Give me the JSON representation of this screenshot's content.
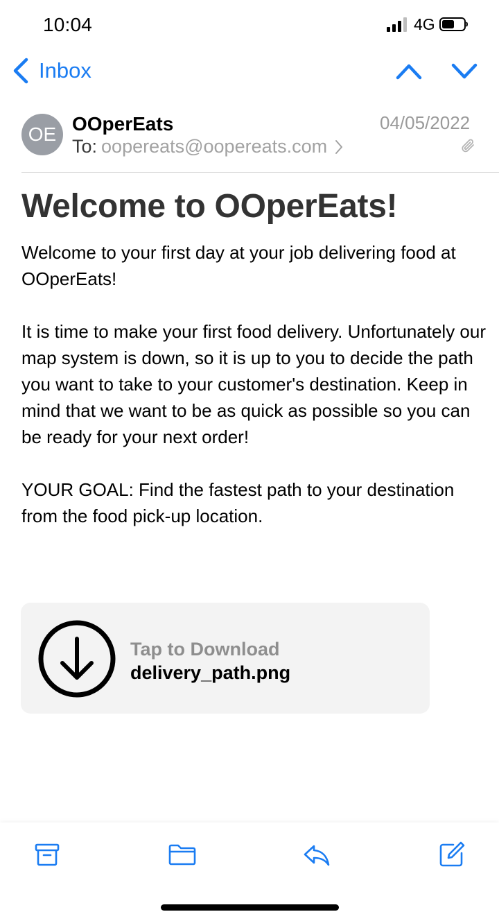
{
  "status_bar": {
    "time": "10:04",
    "network": "4G"
  },
  "nav": {
    "back_label": "Inbox",
    "back_icon": "chevron-left-icon",
    "prev_icon": "chevron-up-icon",
    "next_icon": "chevron-down-icon"
  },
  "header": {
    "avatar_initials": "OE",
    "sender": "OOperEats",
    "to_label": "To:",
    "to_address": "oopereats@oopereats.com",
    "date": "04/05/2022",
    "attachment_indicator_icon": "paperclip-icon"
  },
  "email": {
    "title": "Welcome to OOperEats!",
    "paragraphs": [
      "Welcome to your first day at your job delivering food at OOperEats!",
      "It is time to make your first food delivery. Unfortunately our map system is down, so it is up to you to decide the path you want to take to your customer's destination. Keep in mind that we want to be as quick as possible so you can be ready for your next order!",
      "YOUR GOAL: Find the fastest path to your destination from the food pick-up location."
    ]
  },
  "attachment": {
    "action_label": "Tap to Download",
    "filename": "delivery_path.png",
    "icon": "download-icon"
  },
  "toolbar": {
    "items": [
      "archive-icon",
      "folder-icon",
      "reply-icon",
      "compose-icon"
    ]
  },
  "colors": {
    "accent": "#1a7cf2",
    "avatar_bg": "#9a9ea5",
    "secondary_text": "#a2a2a2",
    "attachment_bg": "#f3f3f3"
  }
}
